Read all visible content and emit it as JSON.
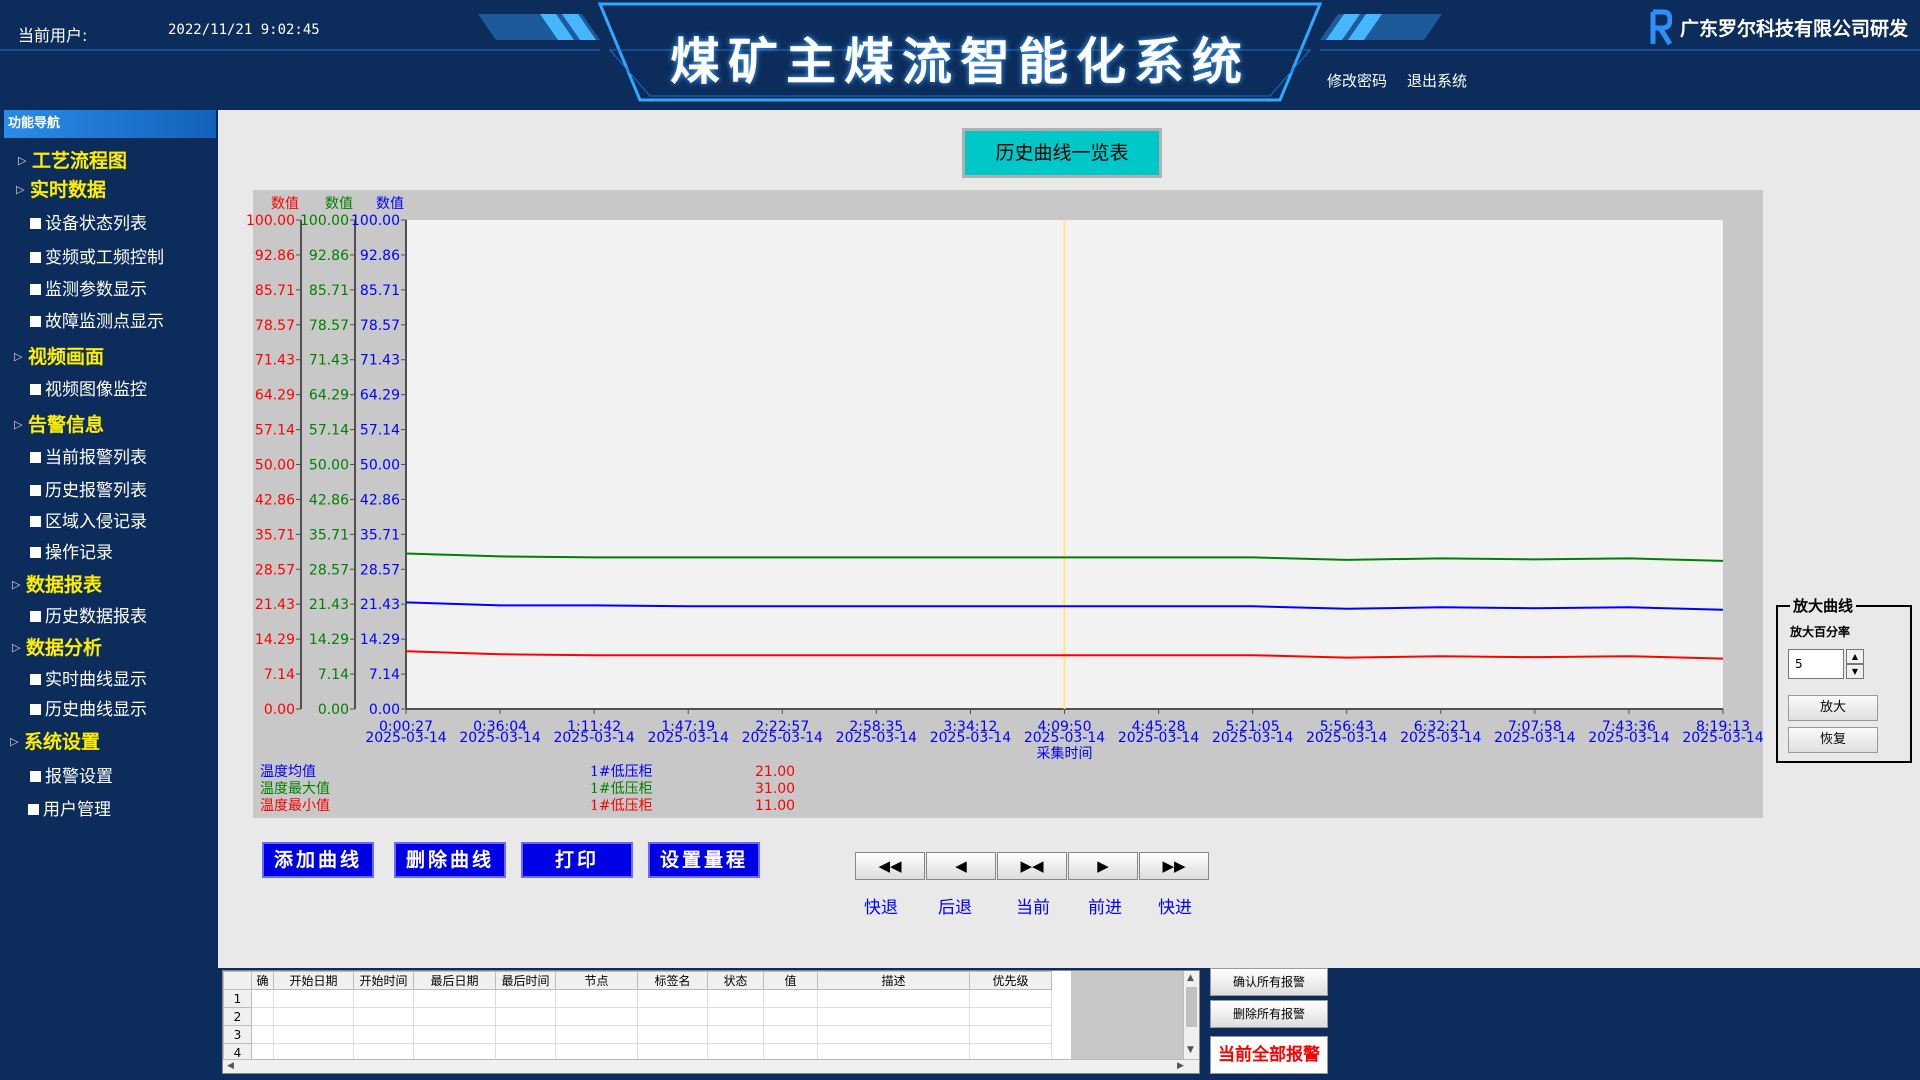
{
  "header": {
    "user_label": "当前用户:",
    "datetime": "2022/11/21  9:02:45",
    "title": "煤矿主煤流智能化系统",
    "company": "广东罗尔科技有限公司研发",
    "change_password": "修改密码",
    "logout": "退出系统"
  },
  "sidebar": {
    "header": "功能导航",
    "items": [
      {
        "type": "cat",
        "label": "工艺流程图"
      },
      {
        "type": "cat",
        "label": "实时数据"
      },
      {
        "type": "item",
        "label": "设备状态列表"
      },
      {
        "type": "item",
        "label": "变频或工频控制"
      },
      {
        "type": "item",
        "label": "监测参数显示"
      },
      {
        "type": "item",
        "label": "故障监测点显示"
      },
      {
        "type": "cat",
        "label": "视频画面"
      },
      {
        "type": "item",
        "label": "视频图像监控"
      },
      {
        "type": "cat",
        "label": "告警信息"
      },
      {
        "type": "item",
        "label": "当前报警列表"
      },
      {
        "type": "item",
        "label": "历史报警列表"
      },
      {
        "type": "item",
        "label": "区域入侵记录"
      },
      {
        "type": "item",
        "label": "操作记录"
      },
      {
        "type": "cat",
        "label": "数据报表"
      },
      {
        "type": "item",
        "label": "历史数据报表"
      },
      {
        "type": "cat",
        "label": "数据分析"
      },
      {
        "type": "item",
        "label": "实时曲线显示"
      },
      {
        "type": "item",
        "label": "历史曲线显示"
      },
      {
        "type": "cat",
        "label": "系统设置"
      },
      {
        "type": "item",
        "label": "报警设置"
      },
      {
        "type": "item",
        "label": "用户管理"
      }
    ]
  },
  "page_title": "历史曲线一览表",
  "chart_data": {
    "type": "line",
    "xlabel": "采集时间",
    "axis_header": "数值",
    "ylim": [
      0,
      100
    ],
    "y_ticks": [
      "100.00",
      "92.86",
      "85.71",
      "78.57",
      "71.43",
      "64.29",
      "57.14",
      "50.00",
      "42.86",
      "35.71",
      "28.57",
      "21.43",
      "14.29",
      "7.14",
      "0.00"
    ],
    "x_ticks": [
      {
        "time": "0:00:27",
        "date": "2025-03-14"
      },
      {
        "time": "0:36:04",
        "date": "2025-03-14"
      },
      {
        "time": "1:11:42",
        "date": "2025-03-14"
      },
      {
        "time": "1:47:19",
        "date": "2025-03-14"
      },
      {
        "time": "2:22:57",
        "date": "2025-03-14"
      },
      {
        "time": "2:58:35",
        "date": "2025-03-14"
      },
      {
        "time": "3:34:12",
        "date": "2025-03-14"
      },
      {
        "time": "4:09:50",
        "date": "2025-03-14"
      },
      {
        "time": "4:45:28",
        "date": "2025-03-14"
      },
      {
        "time": "5:21:05",
        "date": "2025-03-14"
      },
      {
        "time": "5:56:43",
        "date": "2025-03-14"
      },
      {
        "time": "6:32:21",
        "date": "2025-03-14"
      },
      {
        "time": "7:07:58",
        "date": "2025-03-14"
      },
      {
        "time": "7:43:36",
        "date": "2025-03-14"
      },
      {
        "time": "8:19:13",
        "date": "2025-03-14"
      }
    ],
    "cursor_time": "4:09:50",
    "series": [
      {
        "name": "温度均值",
        "color": "#0000ff",
        "tag": "1#低压柜",
        "cursor_value": "21.00",
        "values": [
          21.8,
          21.2,
          21.2,
          21.0,
          21.0,
          21.0,
          21.0,
          21.0,
          21.0,
          21.0,
          20.5,
          20.8,
          20.6,
          20.8,
          20.3
        ]
      },
      {
        "name": "温度最大值",
        "color": "#008000",
        "tag": "1#低压柜",
        "cursor_value": "31.00",
        "values": [
          31.8,
          31.2,
          31.0,
          31.0,
          31.0,
          31.0,
          31.0,
          31.0,
          31.0,
          31.0,
          30.5,
          30.8,
          30.6,
          30.8,
          30.3
        ]
      },
      {
        "name": "温度最小值",
        "color": "#ff0000",
        "tag": "1#低压柜",
        "cursor_value": "11.00",
        "values": [
          11.8,
          11.2,
          11.0,
          11.0,
          11.0,
          11.0,
          11.0,
          11.0,
          11.0,
          11.0,
          10.5,
          10.8,
          10.6,
          10.8,
          10.3
        ]
      }
    ]
  },
  "actions": {
    "add_curve": "添加曲线",
    "delete_curve": "删除曲线",
    "print": "打印",
    "set_range": "设置量程"
  },
  "transport": [
    {
      "glyph": "◀◀",
      "label": "快退"
    },
    {
      "glyph": "◀",
      "label": "后退"
    },
    {
      "glyph": "▶◀",
      "label": "当前"
    },
    {
      "glyph": "▶",
      "label": "前进"
    },
    {
      "glyph": "▶▶",
      "label": "快进"
    }
  ],
  "zoom": {
    "title": "放大曲线",
    "label": "放大百分率",
    "value": "5",
    "zoom_btn": "放大",
    "restore_btn": "恢复"
  },
  "alarm_table": {
    "columns": [
      "确",
      "开始日期",
      "开始时间",
      "最后日期",
      "最后时间",
      "节点",
      "标签名",
      "状态",
      "值",
      "描述",
      "优先级"
    ],
    "rows": [
      "1",
      "2",
      "3",
      "4"
    ]
  },
  "alarm_buttons": {
    "confirm_all": "确认所有报警",
    "delete_all": "删除所有报警",
    "current_all": "当前全部报警"
  }
}
